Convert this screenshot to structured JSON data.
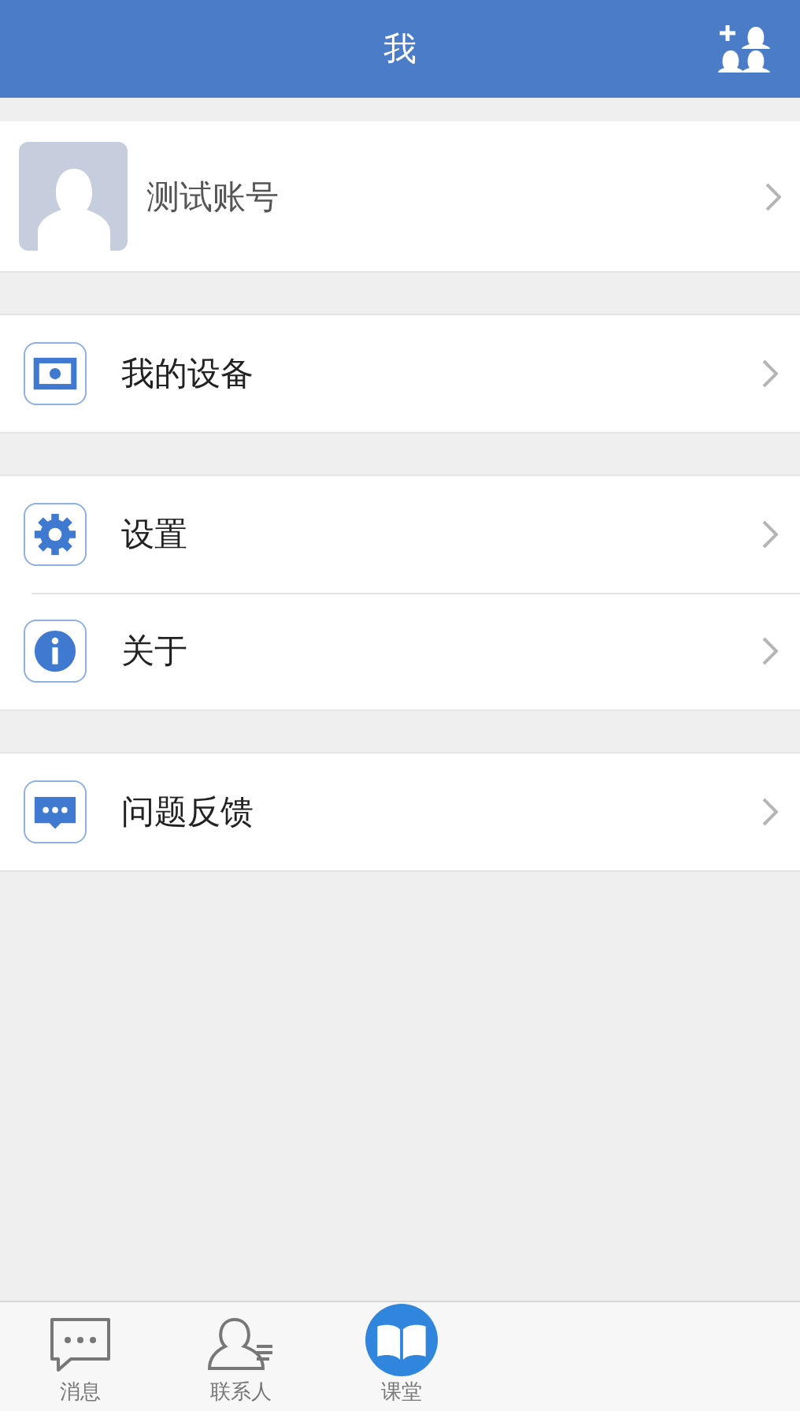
{
  "header": {
    "title": "我"
  },
  "profile": {
    "name": "测试账号"
  },
  "groups": [
    {
      "items": [
        {
          "kind": "device",
          "label": "我的设备"
        }
      ]
    },
    {
      "items": [
        {
          "kind": "gear",
          "label": "设置"
        },
        {
          "kind": "info",
          "label": "关于"
        }
      ]
    },
    {
      "items": [
        {
          "kind": "chat",
          "label": "问题反馈"
        }
      ]
    }
  ],
  "tabs": [
    {
      "kind": "chat",
      "label": "消息",
      "selected": false
    },
    {
      "kind": "contacts",
      "label": "联系人",
      "selected": false
    },
    {
      "kind": "book",
      "label": "课堂",
      "selected": true
    }
  ]
}
